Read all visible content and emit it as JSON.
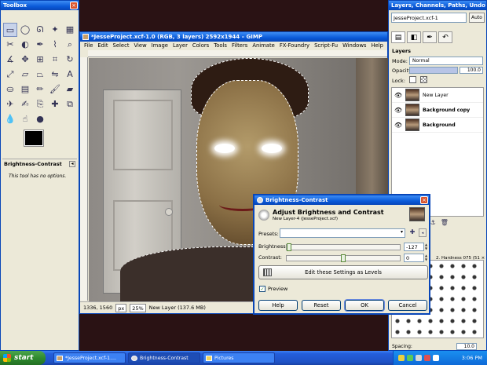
{
  "toolbox": {
    "title": "Toolbox",
    "tools": [
      "rect-select-icon",
      "ellipse-select-icon",
      "lasso-icon",
      "fuzzy-select-icon",
      "color-select-icon",
      "scissors-icon",
      "foreground-select-icon",
      "paths-icon",
      "color-picker-icon",
      "zoom-icon",
      "measure-icon",
      "move-icon",
      "align-icon",
      "crop-icon",
      "rotate-icon",
      "scale-icon",
      "shear-icon",
      "perspective-icon",
      "flip-icon",
      "text-icon",
      "bucket-fill-icon",
      "blend-icon",
      "pencil-icon",
      "paintbrush-icon",
      "eraser-icon",
      "airbrush-icon",
      "ink-icon",
      "clone-icon",
      "heal-icon",
      "perspective-clone-icon",
      "blur-icon",
      "smudge-icon",
      "dodge-icon"
    ],
    "options_title": "Brightness-Contrast",
    "options_text": "This tool has no options."
  },
  "image_window": {
    "title": "*JesseProject.xcf-1.0 (RGB, 3 layers) 2592x1944 – GIMP",
    "menu": [
      "File",
      "Edit",
      "Select",
      "View",
      "Image",
      "Layer",
      "Colors",
      "Tools",
      "Filters",
      "Animate",
      "FX-Foundry",
      "Script-Fu",
      "Windows",
      "Help"
    ],
    "status": {
      "coords": "1336, 1560",
      "unit": "px",
      "zoom": "25%",
      "layer_info": "New Layer (137.6 MB)"
    }
  },
  "layers_dock": {
    "title": "Layers, Channels, Paths, Undo –",
    "image_select": "JesseProject.xcf-1",
    "auto_label": "Auto",
    "section": "Layers",
    "mode_label": "Mode:",
    "mode_value": "Normal",
    "opacity_label": "Opacity:",
    "opacity_value": "100.0",
    "lock_label": "Lock:",
    "layers": [
      {
        "name": "New Layer",
        "bold": false
      },
      {
        "name": "Background copy",
        "bold": true
      },
      {
        "name": "Background",
        "bold": true
      }
    ],
    "brush_label": "2. Hardness 075 (51 × 51)",
    "spacing_label": "Spacing:",
    "spacing_value": "10.0"
  },
  "dialog": {
    "title": "Brightness-Contrast",
    "heading": "Adjust Brightness and Contrast",
    "subheading": "New Layer-4 (JesseProject.xcf)",
    "presets_label": "Presets:",
    "brightness_label": "Brightness:",
    "brightness_value": "-127",
    "brightness_fraction": 0.0,
    "contrast_label": "Contrast:",
    "contrast_value": "0",
    "contrast_fraction": 0.5,
    "levels_button": "Edit these Settings as Levels",
    "preview_label": "Preview",
    "preview_checked": true,
    "buttons": {
      "help": "Help",
      "reset": "Reset",
      "ok": "OK",
      "cancel": "Cancel"
    }
  },
  "taskbar": {
    "start_label": "start",
    "tasks": [
      "*JesseProject.xcf-1....",
      "Brightness-Contrast",
      "Pictures"
    ],
    "clock": "3:06 PM"
  },
  "colors": {
    "xp_blue": "#0846b8",
    "start_green": "#2f8a2f"
  }
}
